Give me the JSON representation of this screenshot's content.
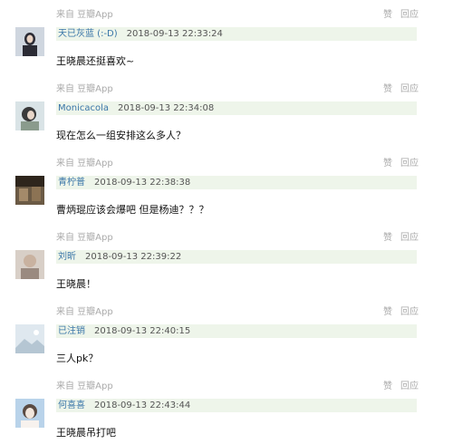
{
  "comments": [
    {
      "source": "来自 豆瓣App",
      "user": "天已灰蓝 (:-D)",
      "time": "2018-09-13 22:33:24",
      "text": "王晓晨还挺喜欢~",
      "like": "赞",
      "reply": "回应",
      "avatar_colors": [
        "#cfd6df",
        "#2b2b35"
      ]
    },
    {
      "source": "来自 豆瓣App",
      "user": "Monicacola",
      "time": "2018-09-13 22:34:08",
      "text": "现在怎么一组安排这么多人？",
      "like": "赞",
      "reply": "回应",
      "avatar_colors": [
        "#d9e3e6",
        "#3a3a3a"
      ]
    },
    {
      "source": "来自 豆瓣App",
      "user": "青柠普",
      "time": "2018-09-13 22:38:38",
      "text": "曹炳琨应该会爆吧 但是杨迪？？？",
      "like": "赞",
      "reply": "回应",
      "avatar_colors": [
        "#6b5a45",
        "#2e251c"
      ]
    },
    {
      "source": "来自 豆瓣App",
      "user": "刘昕",
      "time": "2018-09-13 22:39:22",
      "text": "王晓晨！",
      "like": "赞",
      "reply": "回应",
      "avatar_colors": [
        "#d8cfc7",
        "#9a8a80"
      ]
    },
    {
      "source": "来自 豆瓣App",
      "user": "已注销",
      "time": "2018-09-13 22:40:15",
      "text": "三人pk？",
      "like": "赞",
      "reply": "回应",
      "avatar_colors": [
        "#dfe8ef",
        "#b5c6d3"
      ]
    },
    {
      "source": "来自 豆瓣App",
      "user": "何喜喜",
      "time": "2018-09-13 22:43:44",
      "text": "王晓晨吊打吧",
      "like": "赞",
      "reply": "回应",
      "avatar_colors": [
        "#b9d3ea",
        "#f2e6dc"
      ]
    }
  ]
}
